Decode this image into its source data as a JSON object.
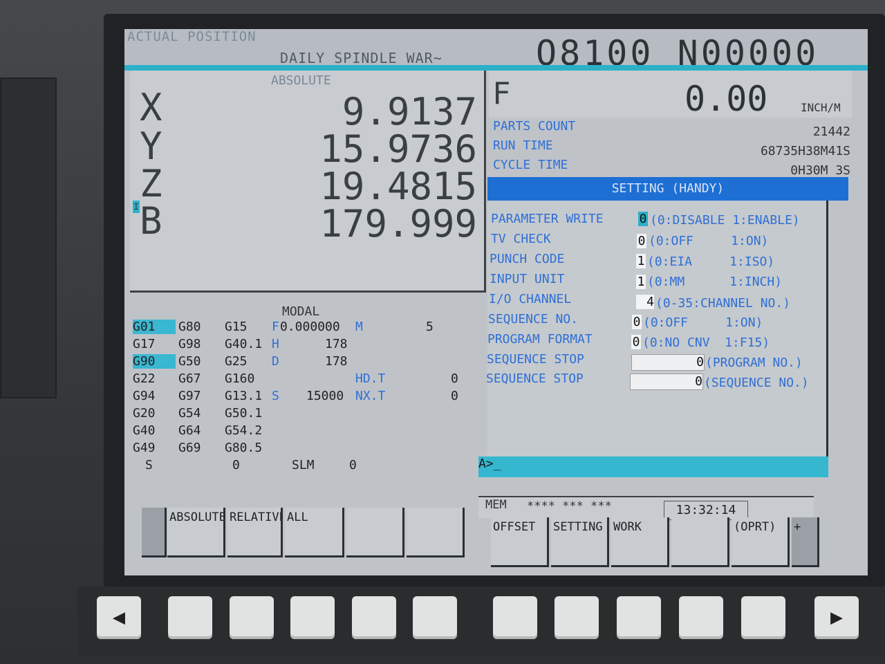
{
  "header": {
    "mode_title": "ACTUAL POSITION",
    "program_name": "DAILY SPINDLE WAR~",
    "program_number": "O8100 N00000"
  },
  "position": {
    "label": "ABSOLUTE",
    "cursor": "I",
    "axes": [
      {
        "name": "X",
        "value": "9.9137"
      },
      {
        "name": "Y",
        "value": "15.9736"
      },
      {
        "name": "Z",
        "value": "19.4815"
      },
      {
        "name": "B",
        "value": "179.999"
      }
    ]
  },
  "modal": {
    "title": "MODAL",
    "col1": [
      "G01",
      "G17",
      "G90",
      "G22",
      "G94",
      "G20",
      "G40",
      "G49"
    ],
    "col2": [
      "G80",
      "G98",
      "G50",
      "G67",
      "G97",
      "G54",
      "G64",
      "G69"
    ],
    "col3": [
      "G15",
      "G40.1",
      "G25",
      "G160",
      "G13.1",
      "G50.1",
      "G54.2",
      "G80.5"
    ],
    "f_label": "F",
    "f_value": "0.000000",
    "m_label": "M",
    "m_value": "5",
    "h_label": "H",
    "h_value": "178",
    "d_label": "D",
    "d_value": "178",
    "hdt_label": "HD.T",
    "hdt_value": "0",
    "s_label": "S",
    "s_value": "15000",
    "nxt_label": "NX.T",
    "nxt_value": "0",
    "s_row_label": "S",
    "s_row_value": "0",
    "slm_label": "SLM",
    "slm_value": "0"
  },
  "feed": {
    "label": "F",
    "value": "0.00",
    "unit": "INCH/M"
  },
  "counters": [
    {
      "label": "PARTS COUNT",
      "value": "21442"
    },
    {
      "label": "RUN TIME",
      "value": "68735H38M41S"
    },
    {
      "label": "CYCLE TIME",
      "value": "0H30M 3S"
    }
  ],
  "setting": {
    "title": "SETTING (HANDY)",
    "params": [
      {
        "name": "PARAMETER WRITE",
        "value": "0",
        "desc": "(0:DISABLE 1:ENABLE)"
      },
      {
        "name": "TV CHECK",
        "value": "0",
        "desc": "(0:OFF     1:ON)"
      },
      {
        "name": "PUNCH CODE",
        "value": "1",
        "desc": "(0:EIA     1:ISO)"
      },
      {
        "name": "INPUT UNIT",
        "value": "1",
        "desc": "(0:MM      1:INCH)"
      },
      {
        "name": "I/O CHANNEL",
        "value": "4",
        "desc": "(0-35:CHANNEL NO.)"
      },
      {
        "name": "SEQUENCE NO.",
        "value": "0",
        "desc": "(0:OFF     1:ON)"
      },
      {
        "name": "PROGRAM FORMAT",
        "value": "0",
        "desc": "(0:NO CNV  1:F15)"
      },
      {
        "name": "SEQUENCE STOP",
        "value": "0",
        "desc": "(PROGRAM NO.)"
      },
      {
        "name": "SEQUENCE STOP",
        "value": "0",
        "desc": "(SEQUENCE NO.)"
      }
    ]
  },
  "command_line": "A>_",
  "status": {
    "mode": "MEM",
    "fields": "**** *** ***",
    "time": "13:32:14"
  },
  "softkeys": {
    "left": [
      "",
      "ABSOLUTE",
      "RELATIVE",
      "ALL",
      "",
      ""
    ],
    "right": [
      "OFFSET",
      "SETTING",
      "WORK",
      "",
      "(OPRT)",
      "+"
    ]
  },
  "hardware": {
    "left_arrow": "◀",
    "right_arrow": "▶"
  },
  "colors": {
    "highlight": "#3ab7d1",
    "label_blue": "#2f6fd6",
    "setting_bar": "#1e6fd4"
  }
}
